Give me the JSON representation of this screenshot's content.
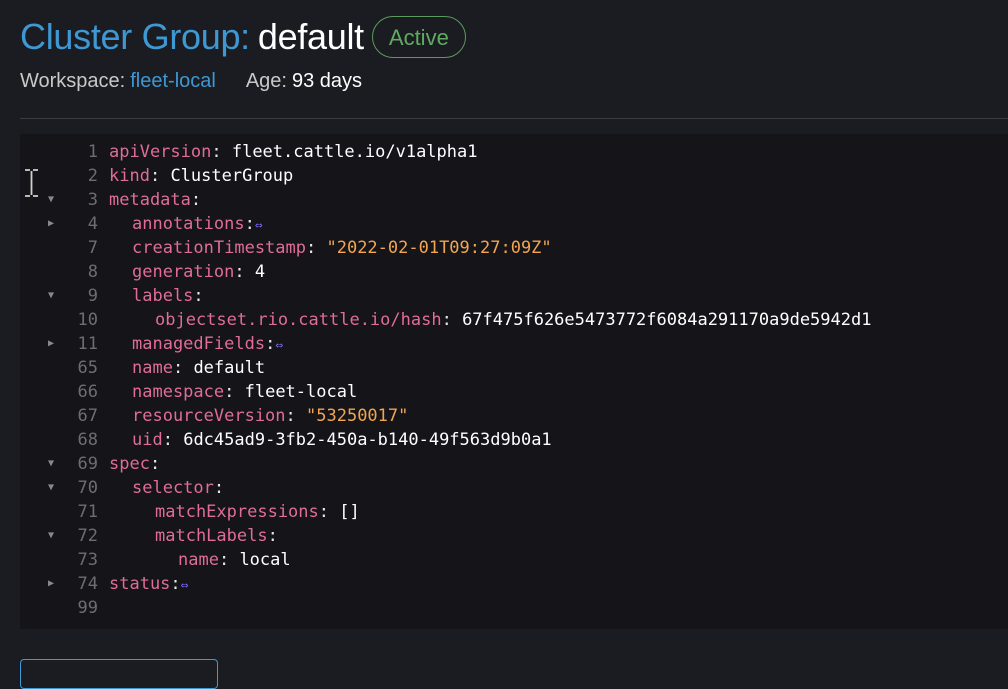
{
  "header": {
    "title_prefix": "Cluster Group:",
    "title_name": "default",
    "state_badge": "Active",
    "workspace_label": "Workspace:",
    "workspace_value": "fleet-local",
    "age_label": "Age:",
    "age_value": "93 days"
  },
  "colors": {
    "accent": "#3d98d3",
    "active_badge": "#5fab61",
    "yaml_key": "#e06c9a",
    "yaml_string": "#f3a550",
    "fold_marker": "#7b6cf6"
  },
  "yaml": {
    "lines": [
      {
        "num": "1",
        "fold": "",
        "indent": 0,
        "key": "apiVersion",
        "sep": ": ",
        "value": "fleet.cattle.io/v1alpha1",
        "value_type": "plain"
      },
      {
        "num": "2",
        "fold": "",
        "indent": 0,
        "key": "kind",
        "sep": ": ",
        "value": "ClusterGroup",
        "value_type": "plain"
      },
      {
        "num": "3",
        "fold": "expanded",
        "indent": 0,
        "key": "metadata",
        "sep": ":",
        "value": "",
        "value_type": "none"
      },
      {
        "num": "4",
        "fold": "collapsed",
        "indent": 1,
        "key": "annotations",
        "sep": ":",
        "value": "⇔",
        "value_type": "collapsed"
      },
      {
        "num": "7",
        "fold": "",
        "indent": 1,
        "key": "creationTimestamp",
        "sep": ": ",
        "value": "\"2022-02-01T09:27:09Z\"",
        "value_type": "string"
      },
      {
        "num": "8",
        "fold": "",
        "indent": 1,
        "key": "generation",
        "sep": ": ",
        "value": "4",
        "value_type": "plain"
      },
      {
        "num": "9",
        "fold": "expanded",
        "indent": 1,
        "key": "labels",
        "sep": ":",
        "value": "",
        "value_type": "none"
      },
      {
        "num": "10",
        "fold": "",
        "indent": 2,
        "key": "objectset.rio.cattle.io/hash",
        "sep": ": ",
        "value": "67f475f626e5473772f6084a291170a9de5942d1",
        "value_type": "plain"
      },
      {
        "num": "11",
        "fold": "collapsed",
        "indent": 1,
        "key": "managedFields",
        "sep": ":",
        "value": "⇔",
        "value_type": "collapsed"
      },
      {
        "num": "65",
        "fold": "",
        "indent": 1,
        "key": "name",
        "sep": ": ",
        "value": "default",
        "value_type": "plain"
      },
      {
        "num": "66",
        "fold": "",
        "indent": 1,
        "key": "namespace",
        "sep": ": ",
        "value": "fleet-local",
        "value_type": "plain"
      },
      {
        "num": "67",
        "fold": "",
        "indent": 1,
        "key": "resourceVersion",
        "sep": ": ",
        "value": "\"53250017\"",
        "value_type": "string"
      },
      {
        "num": "68",
        "fold": "",
        "indent": 1,
        "key": "uid",
        "sep": ": ",
        "value": "6dc45ad9-3fb2-450a-b140-49f563d9b0a1",
        "value_type": "plain"
      },
      {
        "num": "69",
        "fold": "expanded",
        "indent": 0,
        "key": "spec",
        "sep": ":",
        "value": "",
        "value_type": "none"
      },
      {
        "num": "70",
        "fold": "expanded",
        "indent": 1,
        "key": "selector",
        "sep": ":",
        "value": "",
        "value_type": "none"
      },
      {
        "num": "71",
        "fold": "",
        "indent": 2,
        "key": "matchExpressions",
        "sep": ": ",
        "value": "[]",
        "value_type": "plain"
      },
      {
        "num": "72",
        "fold": "expanded",
        "indent": 2,
        "key": "matchLabels",
        "sep": ":",
        "value": "",
        "value_type": "none"
      },
      {
        "num": "73",
        "fold": "",
        "indent": 3,
        "key": "name",
        "sep": ": ",
        "value": "local",
        "value_type": "plain"
      },
      {
        "num": "74",
        "fold": "collapsed",
        "indent": 0,
        "key": "status",
        "sep": ":",
        "value": "⇔",
        "value_type": "collapsed"
      },
      {
        "num": "99",
        "fold": "",
        "indent": 0,
        "key": "",
        "sep": "",
        "value": "",
        "value_type": "none"
      }
    ]
  }
}
